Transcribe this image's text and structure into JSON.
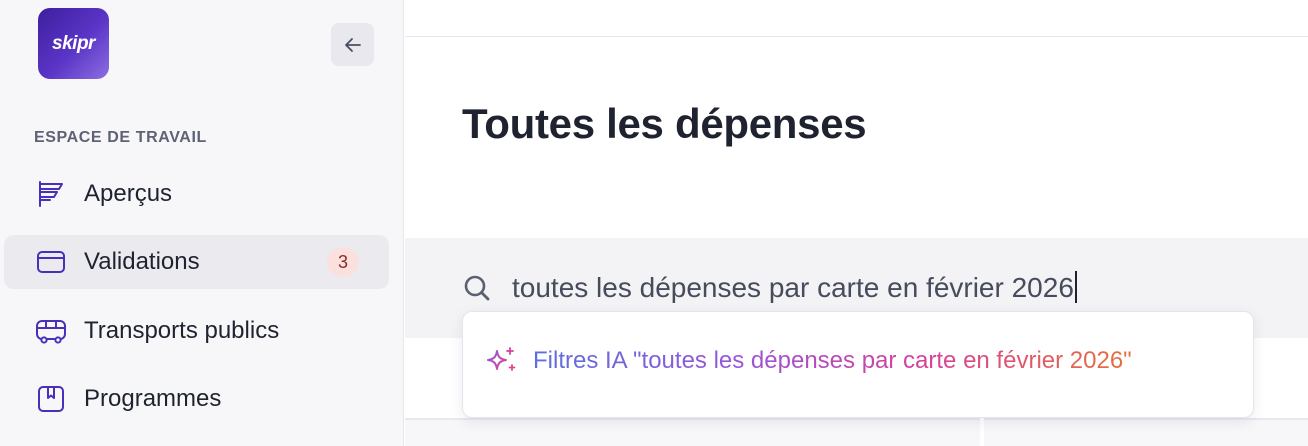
{
  "sidebar": {
    "logo_text": "skipr",
    "section_label": "ESPACE DE TRAVAIL",
    "items": [
      {
        "label": "Aperçus",
        "icon": "overview-icon",
        "active": false
      },
      {
        "label": "Validations",
        "icon": "card-icon",
        "active": true,
        "badge": "3"
      },
      {
        "label": "Transports publics",
        "icon": "bus-icon",
        "active": false
      },
      {
        "label": "Programmes",
        "icon": "bookmark-book-icon",
        "active": false
      }
    ]
  },
  "main": {
    "title": "Toutes les dépenses",
    "search": {
      "value": "toutes les dépenses par carte en février 2026"
    },
    "suggestion": {
      "label": "Filtres IA \"toutes les dépenses par carte en février 2026\""
    }
  },
  "colors": {
    "accent": "#4a2fb8",
    "badge_bg": "#fbe1de",
    "badge_text": "#8e2a20"
  }
}
